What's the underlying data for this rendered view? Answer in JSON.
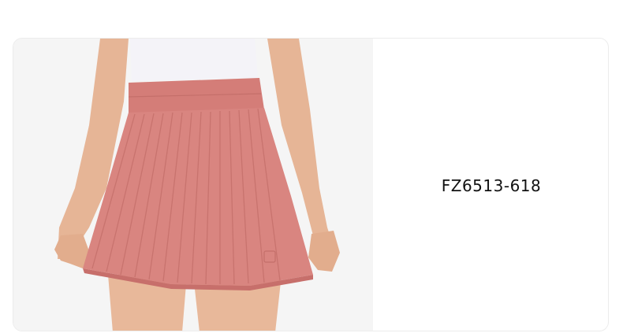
{
  "product": {
    "sku": "FZ6513-618",
    "image_name": "pink-pleated-tennis-skirt-photo"
  },
  "colors": {
    "image_background": "#f5f5f5",
    "skirt": "#d98580",
    "skirt_shadow": "#c76f6b",
    "waistband": "#d47d78",
    "top": "#f4f3f8",
    "skin": "#e8b89a",
    "text": "#111111"
  }
}
